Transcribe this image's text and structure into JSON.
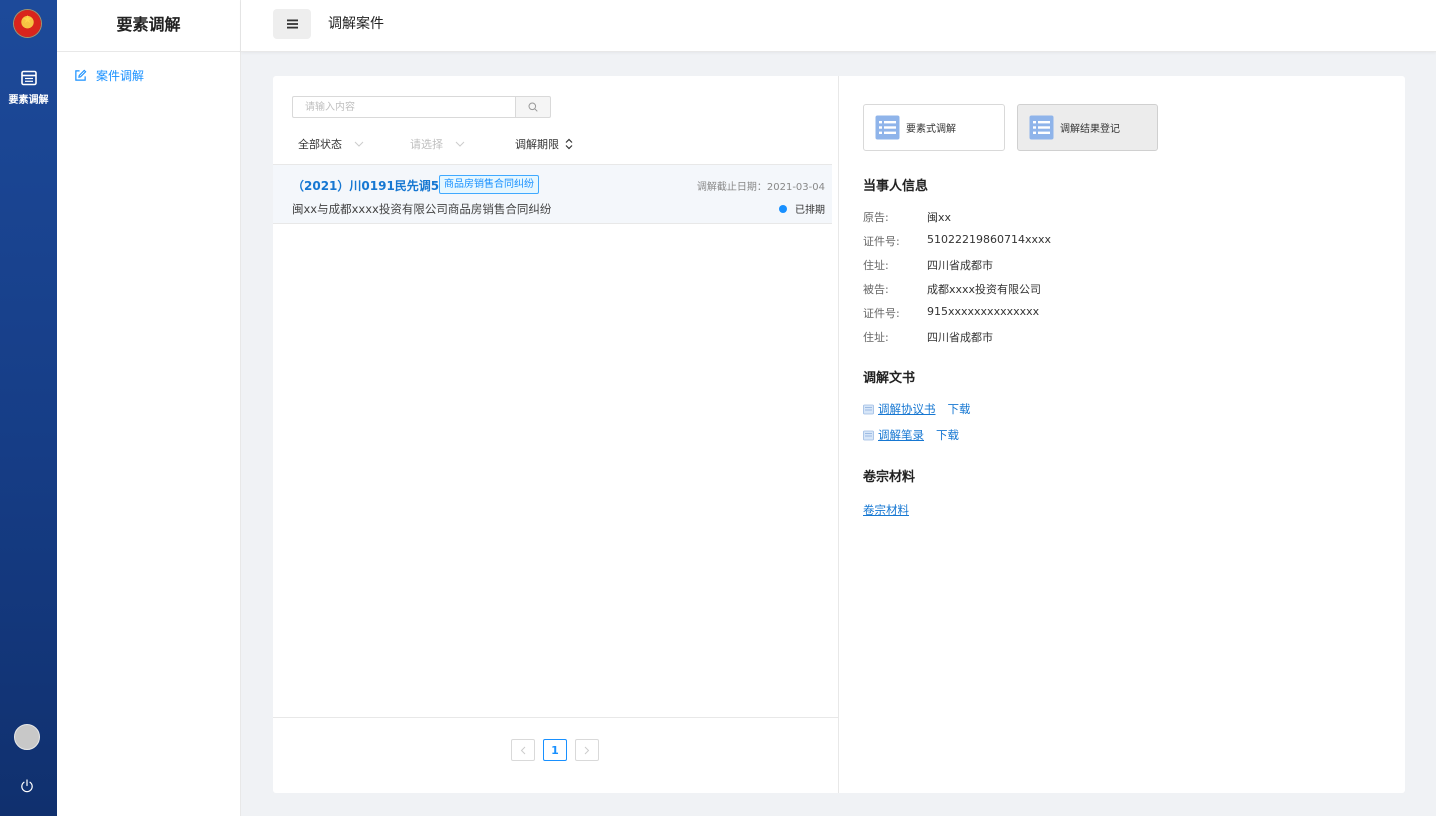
{
  "rail": {
    "nav_label": "要素调解"
  },
  "menu": {
    "title": "要素调解",
    "items": [
      {
        "label": "案件调解",
        "icon": "edit-icon"
      }
    ]
  },
  "header": {
    "title": "调解案件"
  },
  "list": {
    "search_placeholder": "请输入内容",
    "filters": {
      "status": "全部状态",
      "select_placeholder": "请选择",
      "deadline_sort": "调解期限"
    },
    "cases": [
      {
        "case_no": "（2021）川0191民先调58号",
        "tag": "商品房销售合同纠纷",
        "deadline": "调解截止日期：2021-03-04",
        "description": "闽xx与成都xxxx投资有限公司商品房销售合同纠纷",
        "status": "已排期"
      }
    ],
    "pagination": {
      "current_page": "1"
    }
  },
  "detail": {
    "actions": {
      "element_mediation": "要素式调解",
      "result_register": "调解结果登记"
    },
    "parties": {
      "title": "当事人信息",
      "rows": [
        {
          "key": "原告:",
          "value": "闽xx"
        },
        {
          "key": "证件号:",
          "value": "51022219860714xxxx"
        },
        {
          "key": "住址:",
          "value": "四川省成都市"
        },
        {
          "key": "被告:",
          "value": "成都xxxx投资有限公司"
        },
        {
          "key": "证件号:",
          "value": "915xxxxxxxxxxxxxx"
        },
        {
          "key": "住址:",
          "value": "四川省成都市"
        }
      ]
    },
    "documents": {
      "title": "调解文书",
      "items": [
        {
          "name": "调解协议书",
          "download": "下载"
        },
        {
          "name": "调解笔录",
          "download": "下载"
        }
      ]
    },
    "files": {
      "title": "卷宗材料",
      "link": "卷宗材料"
    }
  },
  "colors": {
    "rail_bg": "#1d4a9a",
    "accent": "#1890ff",
    "link": "#1677d2"
  }
}
